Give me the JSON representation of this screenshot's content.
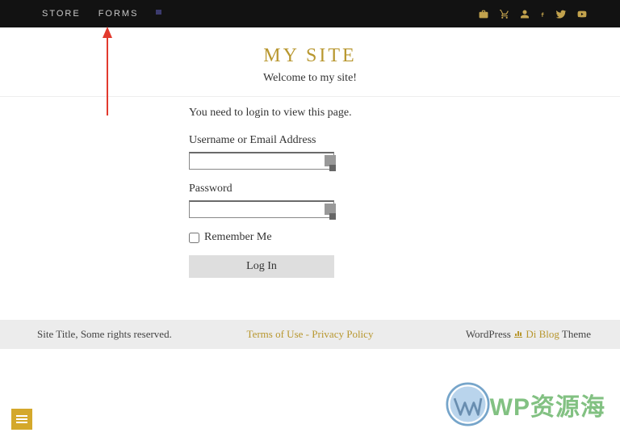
{
  "topbar": {
    "store": "STORE",
    "forms": "FORMS"
  },
  "header": {
    "title": "MY SITE",
    "welcome": "Welcome to my site!"
  },
  "login": {
    "message": "You need to login to view this page.",
    "username_label": "Username or Email Address",
    "password_label": "Password",
    "remember_label": "Remember Me",
    "button_label": "Log In"
  },
  "footer": {
    "left": "Site Title, Some rights reserved.",
    "terms": "Terms of Use",
    "sep": " - ",
    "privacy": "Privacy Policy",
    "right_prefix": "WordPress ",
    "right_brand": "Di Blog",
    "right_suffix": " Theme"
  },
  "watermark": {
    "text": "WP资源海"
  }
}
